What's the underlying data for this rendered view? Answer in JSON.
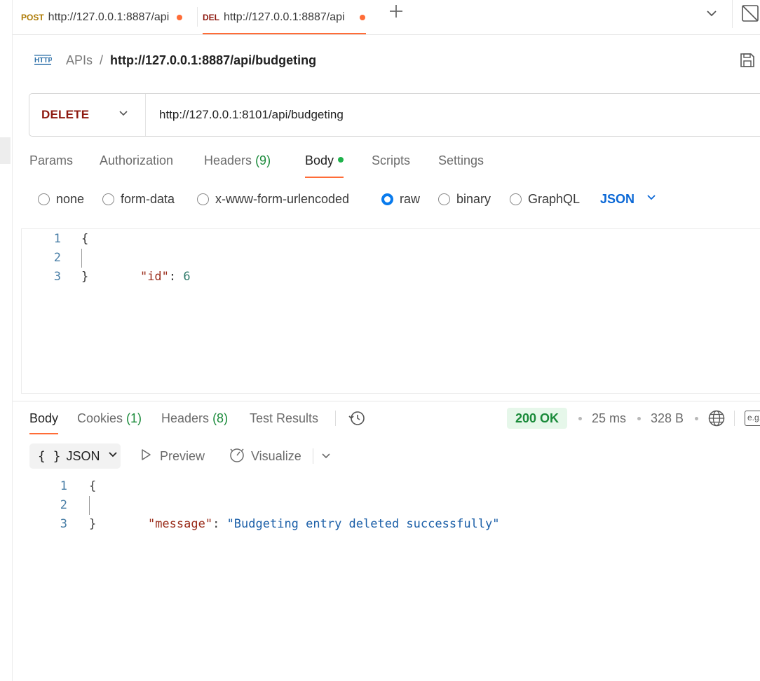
{
  "tabs": [
    {
      "method": "POST",
      "url": "http://127.0.0.1:8887/api"
    },
    {
      "method": "DEL",
      "url": "http://127.0.0.1:8887/api"
    }
  ],
  "breadcrumb": {
    "parent": "APIs",
    "separator": "/",
    "current": "http://127.0.0.1:8887/api/budgeting"
  },
  "request": {
    "method": "DELETE",
    "url": "http://127.0.0.1:8101/api/budgeting",
    "tabs": {
      "params": "Params",
      "authorization": "Authorization",
      "headers": "Headers",
      "headers_count": "(9)",
      "body": "Body",
      "scripts": "Scripts",
      "settings": "Settings"
    },
    "body_modes": {
      "none": "none",
      "form_data": "form-data",
      "urlencoded": "x-www-form-urlencoded",
      "raw": "raw",
      "binary": "binary",
      "graphql": "GraphQL",
      "language": "JSON",
      "selected": "raw"
    },
    "editor": {
      "line_numbers": [
        "1",
        "2",
        "3"
      ],
      "open_brace": "{",
      "key": "\"id\"",
      "colon": ": ",
      "value": "6",
      "close_brace": "}"
    }
  },
  "response": {
    "tabs": {
      "body": "Body",
      "cookies": "Cookies",
      "cookies_count": "(1)",
      "headers": "Headers",
      "headers_count": "(8)",
      "test_results": "Test Results"
    },
    "status": "200 OK",
    "time": "25 ms",
    "size": "328 B",
    "example_label": "e.g.",
    "toolbar": {
      "format": "JSON",
      "braces": "{ }",
      "preview": "Preview",
      "visualize": "Visualize"
    },
    "editor": {
      "line_numbers": [
        "1",
        "2",
        "3"
      ],
      "open_brace": "{",
      "key": "\"message\"",
      "colon": ": ",
      "value": "\"Budgeting entry deleted successfully\"",
      "close_brace": "}"
    }
  },
  "colors": {
    "accent": "#ff6c37",
    "delete_method": "#8e1a10",
    "post_method": "#ad7a03",
    "success": "#1a8a3a",
    "link_blue": "#0b68d6"
  }
}
